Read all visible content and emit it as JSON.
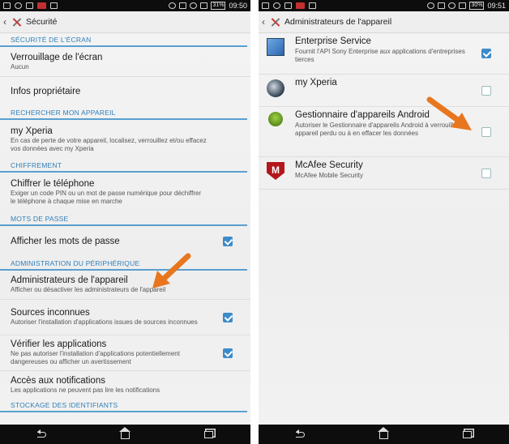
{
  "left": {
    "statusbar": {
      "battery": "31%",
      "time": "09:50"
    },
    "title": "Sécurité",
    "sections": [
      {
        "header": "SÉCURITÉ DE L'ÉCRAN"
      },
      {
        "header": "RECHERCHER MON APPAREIL"
      },
      {
        "header": "CHIFFREMENT"
      },
      {
        "header": "MOTS DE PASSE"
      },
      {
        "header": "ADMINISTRATION DU PÉRIPHÉRIQUE"
      },
      {
        "header": "STOCKAGE DES IDENTIFIANTS"
      }
    ],
    "items": [
      {
        "title": "Verrouillage de l'écran",
        "sub": "Aucun"
      },
      {
        "title": "Infos propriétaire",
        "sub": ""
      },
      {
        "title": "my Xperia",
        "sub": "En cas de perte de votre appareil, localisez, verrouillez et/ou effacez vos données avec my Xperia"
      },
      {
        "title": "Chiffrer le téléphone",
        "sub": "Exiger un code PIN ou un mot de passe numérique pour déchiffrer le téléphone à chaque mise en marche"
      },
      {
        "title": "Afficher les mots de passe",
        "sub": "",
        "checked": true
      },
      {
        "title": "Administrateurs de l'appareil",
        "sub": "Afficher ou désactiver les administrateurs de l'appareil"
      },
      {
        "title": "Sources inconnues",
        "sub": "Autoriser l'installation d'applications issues de sources inconnues",
        "checked": true
      },
      {
        "title": "Vérifier les applications",
        "sub": "Ne pas autoriser l'installation d'applications potentiellement dangereuses ou afficher un avertissement",
        "checked": true
      },
      {
        "title": "Accès aux notifications",
        "sub": "Les applications ne peuvent pas lire les notifications"
      }
    ]
  },
  "right": {
    "statusbar": {
      "battery": "30%",
      "time": "09:51"
    },
    "title": "Administrateurs de l'appareil",
    "items": [
      {
        "title": "Enterprise Service",
        "sub": "Fournit l'API Sony Enterprise aux applications d'entreprises tierces",
        "checked": true,
        "icon": "enterprise-service-icon"
      },
      {
        "title": "my Xperia",
        "sub": "",
        "checked": false,
        "icon": "my-xperia-icon"
      },
      {
        "title": "Gestionnaire d'appareils Android",
        "sub": "Autoriser le Gestionnaire d'appareils Android à verrouiller un appareil perdu ou à en effacer les données",
        "checked": false,
        "icon": "android-device-manager-icon"
      },
      {
        "title": "McAfee Security",
        "sub": "McAfee Mobile Security",
        "checked": false,
        "icon": "mcafee-icon",
        "icon_text": "M"
      }
    ]
  },
  "colors": {
    "accent": "#3d8bc9",
    "section_text": "#2f7fb8",
    "arrow": "#e8761e",
    "bars": "#0d0d0d"
  }
}
